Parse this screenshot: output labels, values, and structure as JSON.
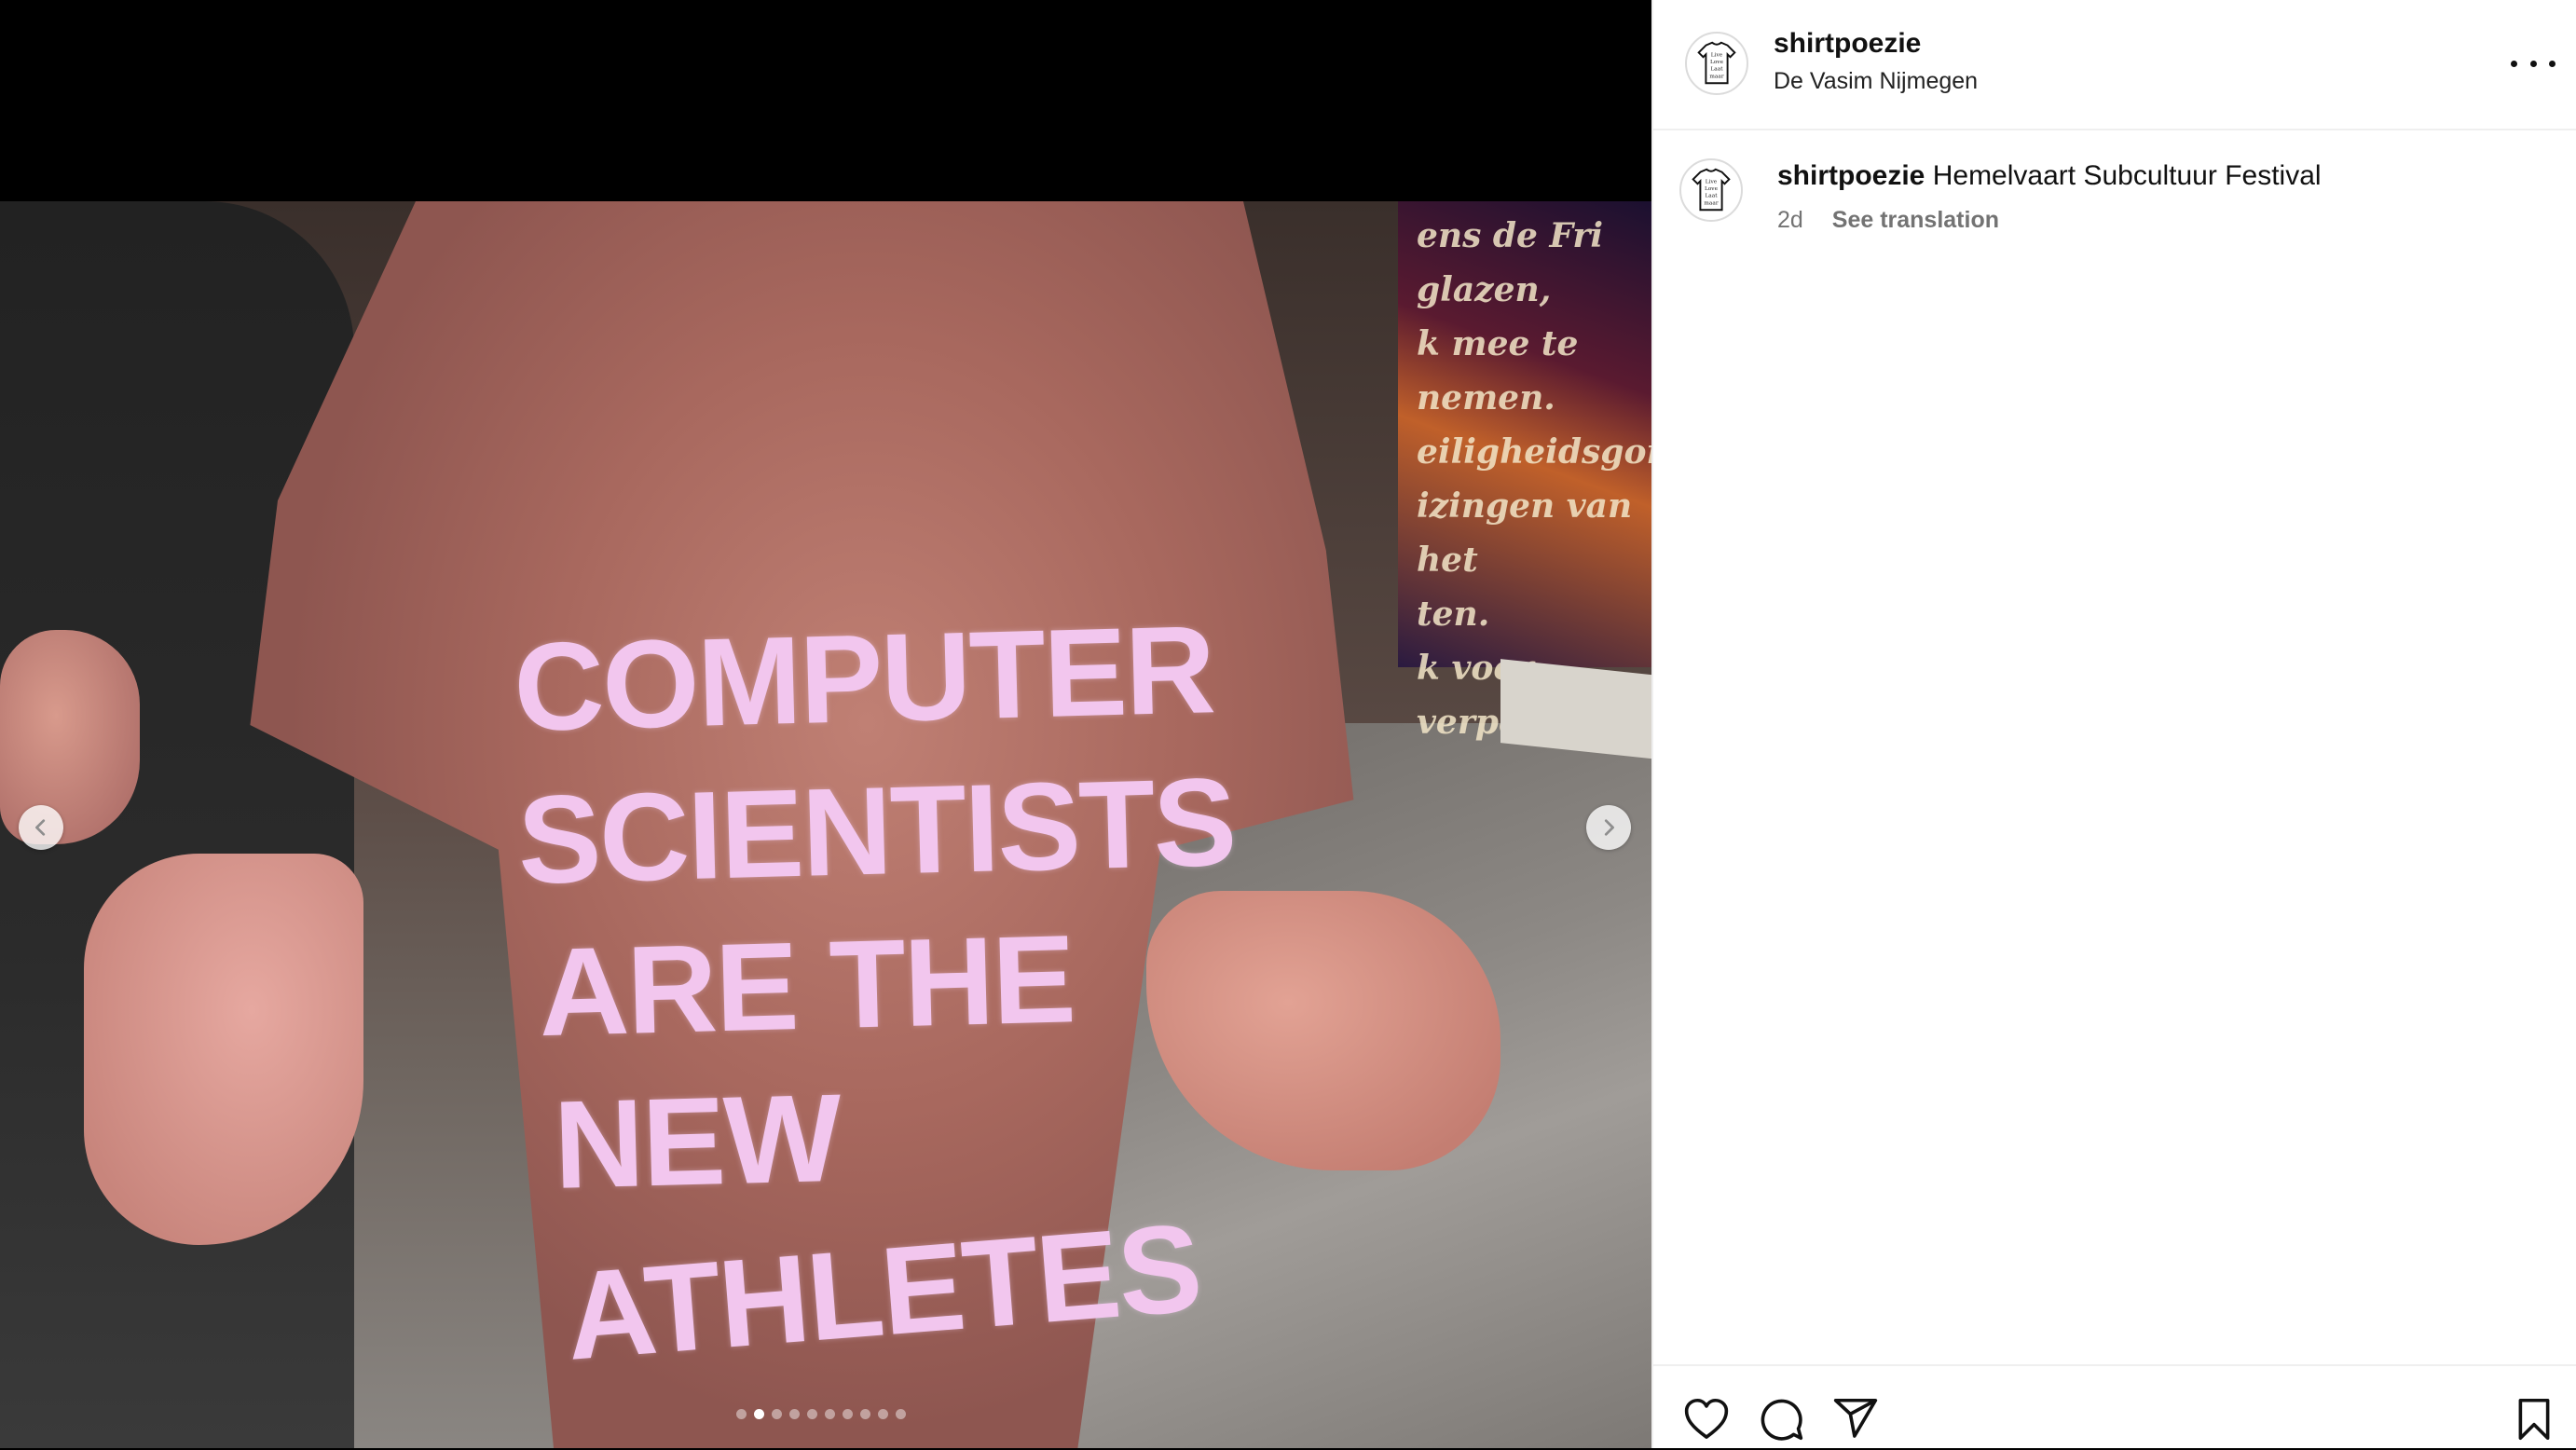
{
  "post": {
    "username": "shirtpoezie",
    "location": "De Vasim Nijmegen",
    "caption_text": "Hemelvaart Subcultuur Festival",
    "time_ago": "2d",
    "see_translation": "See translation"
  },
  "photo": {
    "shirt_text": [
      "COMPUTER",
      "SCIENTISTS",
      "ARE THE",
      "NEW",
      "ATHLETES"
    ],
    "poster_text": "ens de Fri glazen,\nk mee te nemen.\neiligheidsgordel.\nizingen van het\nten.\nk voor\nverpen."
  },
  "carousel": {
    "total_slides": 10,
    "active_index": 1
  },
  "icons": {
    "prev": "chevron-left-icon",
    "next": "chevron-right-icon",
    "more": "more-options-icon",
    "like": "heart-icon",
    "comment": "comment-icon",
    "share": "share-icon",
    "save": "bookmark-icon",
    "avatar": "tshirt-logo-icon"
  }
}
